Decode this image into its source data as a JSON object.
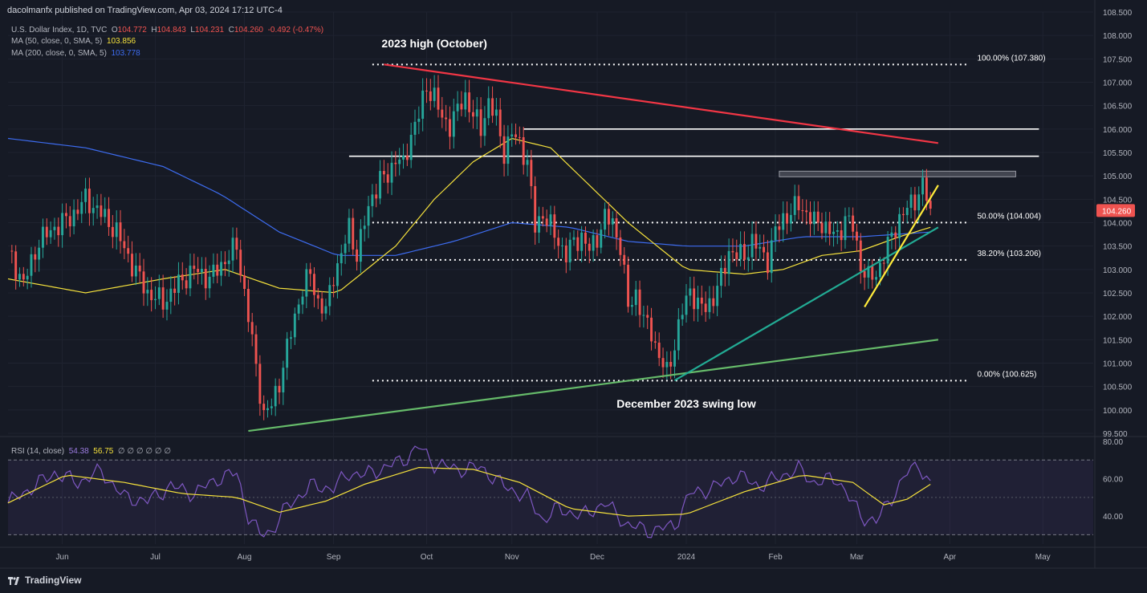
{
  "publisher": "dacolmanfx published on TradingView.com, Apr 03, 2024 17:12 UTC-4",
  "symbol_line": {
    "name": "U.S. Dollar Index, 1D, TVC",
    "o_label": "O",
    "o": "104.772",
    "h_label": "H",
    "h": "104.843",
    "l_label": "L",
    "l": "104.231",
    "c_label": "C",
    "c": "104.260",
    "change": "-0.492 (-0.47%)"
  },
  "ma50_line": {
    "label": "MA (50, close, 0, SMA, 5)",
    "value": "103.856",
    "color": "#f5e13c"
  },
  "ma200_line": {
    "label": "MA (200, close, 0, SMA, 5)",
    "value": "103.778",
    "color": "#3d6cf0"
  },
  "rsi_line": {
    "label": "RSI (14, close)",
    "value1": "54.38",
    "value2": "56.75",
    "nulls": "∅ ∅ ∅ ∅ ∅ ∅"
  },
  "footer": {
    "brand": "TradingView"
  },
  "colors": {
    "background": "#161a25",
    "up": "#26a69a",
    "down": "#ef5350",
    "ma50": "#f5e13c",
    "ma200": "#3d6cf0",
    "rsi": "#7e57c2",
    "rsi_ma": "#f5e13c"
  },
  "chart_data": {
    "type": "candlestick",
    "title": "",
    "xlabel": "",
    "ylabel": "",
    "ylim": [
      99.5,
      108.5
    ],
    "y_ticks": [
      "108.500",
      "108.000",
      "107.500",
      "107.000",
      "106.500",
      "106.000",
      "105.500",
      "105.000",
      "104.500",
      "104.000",
      "103.500",
      "103.000",
      "102.500",
      "102.000",
      "101.500",
      "101.000",
      "100.500",
      "100.000",
      "99.500"
    ],
    "x_ticks": [
      "Jun",
      "Jul",
      "Aug",
      "Sep",
      "Oct",
      "Nov",
      "Dec",
      "2024",
      "Feb",
      "Mar",
      "Apr",
      "May"
    ],
    "last_price": "104.260",
    "close_series": [
      [
        0,
        103.4
      ],
      [
        4,
        102.7
      ],
      [
        8,
        103.6
      ],
      [
        12,
        103.9
      ],
      [
        16,
        104.1
      ],
      [
        20,
        104.5
      ],
      [
        24,
        104.2
      ],
      [
        28,
        103.8
      ],
      [
        32,
        103.1
      ],
      [
        36,
        102.5
      ],
      [
        40,
        102.3
      ],
      [
        44,
        102.7
      ],
      [
        48,
        103.0
      ],
      [
        52,
        102.8
      ],
      [
        56,
        103.2
      ],
      [
        59,
        103.5
      ],
      [
        62,
        102.0
      ],
      [
        64,
        100.9
      ],
      [
        66,
        99.9
      ],
      [
        68,
        100.1
      ],
      [
        70,
        100.6
      ],
      [
        72,
        101.3
      ],
      [
        74,
        102.0
      ],
      [
        76,
        102.6
      ],
      [
        78,
        102.9
      ],
      [
        80,
        102.3
      ],
      [
        82,
        102.1
      ],
      [
        84,
        102.9
      ],
      [
        86,
        103.3
      ],
      [
        88,
        103.9
      ],
      [
        90,
        103.3
      ],
      [
        92,
        104.0
      ],
      [
        94,
        104.6
      ],
      [
        96,
        104.9
      ],
      [
        98,
        105.0
      ],
      [
        100,
        105.4
      ],
      [
        102,
        105.2
      ],
      [
        104,
        105.9
      ],
      [
        106,
        106.3
      ],
      [
        108,
        106.9
      ],
      [
        110,
        106.7
      ],
      [
        112,
        106.2
      ],
      [
        114,
        106.1
      ],
      [
        116,
        106.4
      ],
      [
        118,
        106.7
      ],
      [
        120,
        106.3
      ],
      [
        122,
        106.0
      ],
      [
        124,
        106.6
      ],
      [
        126,
        106.2
      ],
      [
        128,
        105.5
      ],
      [
        130,
        105.9
      ],
      [
        132,
        105.7
      ],
      [
        134,
        105.3
      ],
      [
        136,
        103.9
      ],
      [
        138,
        104.2
      ],
      [
        140,
        103.9
      ],
      [
        142,
        103.6
      ],
      [
        144,
        103.3
      ],
      [
        146,
        103.6
      ],
      [
        148,
        103.7
      ],
      [
        150,
        103.4
      ],
      [
        152,
        103.7
      ],
      [
        154,
        104.1
      ],
      [
        156,
        104.0
      ],
      [
        158,
        103.5
      ],
      [
        160,
        102.2
      ],
      [
        162,
        102.5
      ],
      [
        164,
        101.9
      ],
      [
        166,
        101.7
      ],
      [
        168,
        101.1
      ],
      [
        170,
        100.8
      ],
      [
        172,
        101.4
      ],
      [
        174,
        102.1
      ],
      [
        176,
        102.6
      ],
      [
        178,
        102.2
      ],
      [
        180,
        102.2
      ],
      [
        182,
        102.4
      ],
      [
        184,
        102.8
      ],
      [
        186,
        103.4
      ],
      [
        188,
        103.3
      ],
      [
        190,
        103.3
      ],
      [
        192,
        103.6
      ],
      [
        194,
        103.4
      ],
      [
        196,
        103.2
      ],
      [
        198,
        103.8
      ],
      [
        200,
        104.1
      ],
      [
        202,
        104.2
      ],
      [
        204,
        104.4
      ],
      [
        206,
        104.2
      ],
      [
        208,
        104.0
      ],
      [
        210,
        104.0
      ],
      [
        212,
        103.8
      ],
      [
        214,
        103.7
      ],
      [
        216,
        104.1
      ],
      [
        218,
        103.9
      ],
      [
        220,
        103.1
      ],
      [
        222,
        102.8
      ],
      [
        224,
        102.9
      ],
      [
        226,
        103.3
      ],
      [
        228,
        103.7
      ],
      [
        230,
        104.1
      ],
      [
        232,
        104.3
      ],
      [
        234,
        104.5
      ],
      [
        236,
        104.8
      ],
      [
        238,
        104.3
      ]
    ],
    "ma50_series": [
      [
        0,
        102.8
      ],
      [
        20,
        102.5
      ],
      [
        40,
        102.8
      ],
      [
        56,
        103.0
      ],
      [
        70,
        102.6
      ],
      [
        85,
        102.5
      ],
      [
        100,
        103.5
      ],
      [
        110,
        104.5
      ],
      [
        120,
        105.3
      ],
      [
        130,
        105.8
      ],
      [
        140,
        105.6
      ],
      [
        150,
        104.8
      ],
      [
        160,
        104.0
      ],
      [
        175,
        103.0
      ],
      [
        190,
        102.9
      ],
      [
        200,
        103.0
      ],
      [
        210,
        103.3
      ],
      [
        220,
        103.4
      ],
      [
        230,
        103.7
      ],
      [
        238,
        103.9
      ]
    ],
    "ma200_series": [
      [
        0,
        105.8
      ],
      [
        20,
        105.6
      ],
      [
        40,
        105.2
      ],
      [
        55,
        104.6
      ],
      [
        70,
        103.8
      ],
      [
        85,
        103.3
      ],
      [
        100,
        103.3
      ],
      [
        115,
        103.6
      ],
      [
        130,
        104.0
      ],
      [
        145,
        103.9
      ],
      [
        160,
        103.6
      ],
      [
        175,
        103.5
      ],
      [
        190,
        103.5
      ],
      [
        205,
        103.7
      ],
      [
        220,
        103.7
      ],
      [
        238,
        103.8
      ]
    ],
    "horizontal_levels": [
      {
        "value": 107.38,
        "style": "dotted",
        "label": "100.00% (107.380)"
      },
      {
        "value": 104.003,
        "style": "dotted",
        "label": "50.00% (104.004)"
      },
      {
        "value": 103.206,
        "style": "dotted",
        "label": "38.20% (103.206)"
      },
      {
        "value": 100.625,
        "style": "dotted",
        "label": "0.00% (100.625)"
      },
      {
        "value": 106.0,
        "style": "solid",
        "label": ""
      },
      {
        "value": 105.42,
        "style": "solid",
        "label": ""
      }
    ],
    "resistance_zone": [
      104.98,
      105.1
    ],
    "trendlines": [
      {
        "name": "red-downtrend",
        "from": [
          97,
          107.38
        ],
        "to": [
          240,
          105.7
        ],
        "color": "#f23645"
      },
      {
        "name": "green-uptrend-long",
        "from": [
          62,
          99.55
        ],
        "to": [
          240,
          101.5
        ],
        "color": "#66bb6a"
      },
      {
        "name": "teal-uptrend",
        "from": [
          172,
          100.63
        ],
        "to": [
          240,
          103.9
        ],
        "color": "#22ab94"
      },
      {
        "name": "yellow-uptrend",
        "from": [
          221,
          102.2
        ],
        "to": [
          240,
          104.8
        ],
        "color": "#ffeb3b"
      }
    ],
    "annotations": [
      {
        "text": "2023 high (October)",
        "x": 110,
        "y": 107.75
      },
      {
        "text": "December 2023 swing low",
        "x": 175,
        "y": 100.05
      }
    ],
    "rsi": {
      "ylim": [
        25,
        80
      ],
      "y_ticks": [
        "80.00",
        "60.00",
        "40.00"
      ],
      "bands": [
        70,
        30
      ],
      "mid": 50,
      "rsi_series": [
        [
          0,
          47
        ],
        [
          6,
          55
        ],
        [
          12,
          63
        ],
        [
          18,
          58
        ],
        [
          24,
          64
        ],
        [
          30,
          50
        ],
        [
          36,
          48
        ],
        [
          42,
          56
        ],
        [
          48,
          52
        ],
        [
          54,
          60
        ],
        [
          59,
          63
        ],
        [
          62,
          40
        ],
        [
          65,
          30
        ],
        [
          68,
          32
        ],
        [
          72,
          45
        ],
        [
          78,
          56
        ],
        [
          84,
          55
        ],
        [
          88,
          63
        ],
        [
          92,
          62
        ],
        [
          96,
          65
        ],
        [
          102,
          70
        ],
        [
          106,
          77
        ],
        [
          110,
          68
        ],
        [
          116,
          65
        ],
        [
          122,
          66
        ],
        [
          128,
          56
        ],
        [
          134,
          50
        ],
        [
          138,
          38
        ],
        [
          142,
          44
        ],
        [
          148,
          40
        ],
        [
          154,
          47
        ],
        [
          160,
          35
        ],
        [
          166,
          32
        ],
        [
          172,
          35
        ],
        [
          176,
          52
        ],
        [
          182,
          55
        ],
        [
          188,
          62
        ],
        [
          194,
          56
        ],
        [
          200,
          62
        ],
        [
          204,
          65
        ],
        [
          208,
          58
        ],
        [
          214,
          60
        ],
        [
          220,
          40
        ],
        [
          224,
          37
        ],
        [
          228,
          50
        ],
        [
          232,
          63
        ],
        [
          235,
          68
        ],
        [
          238,
          56
        ]
      ],
      "rsi_ma_series": [
        [
          0,
          47
        ],
        [
          15,
          62
        ],
        [
          30,
          58
        ],
        [
          45,
          52
        ],
        [
          59,
          50
        ],
        [
          70,
          42
        ],
        [
          82,
          48
        ],
        [
          92,
          57
        ],
        [
          106,
          66
        ],
        [
          120,
          65
        ],
        [
          132,
          58
        ],
        [
          145,
          44
        ],
        [
          160,
          40
        ],
        [
          175,
          41
        ],
        [
          190,
          53
        ],
        [
          205,
          62
        ],
        [
          218,
          58
        ],
        [
          226,
          46
        ],
        [
          232,
          49
        ],
        [
          238,
          57
        ]
      ]
    }
  }
}
